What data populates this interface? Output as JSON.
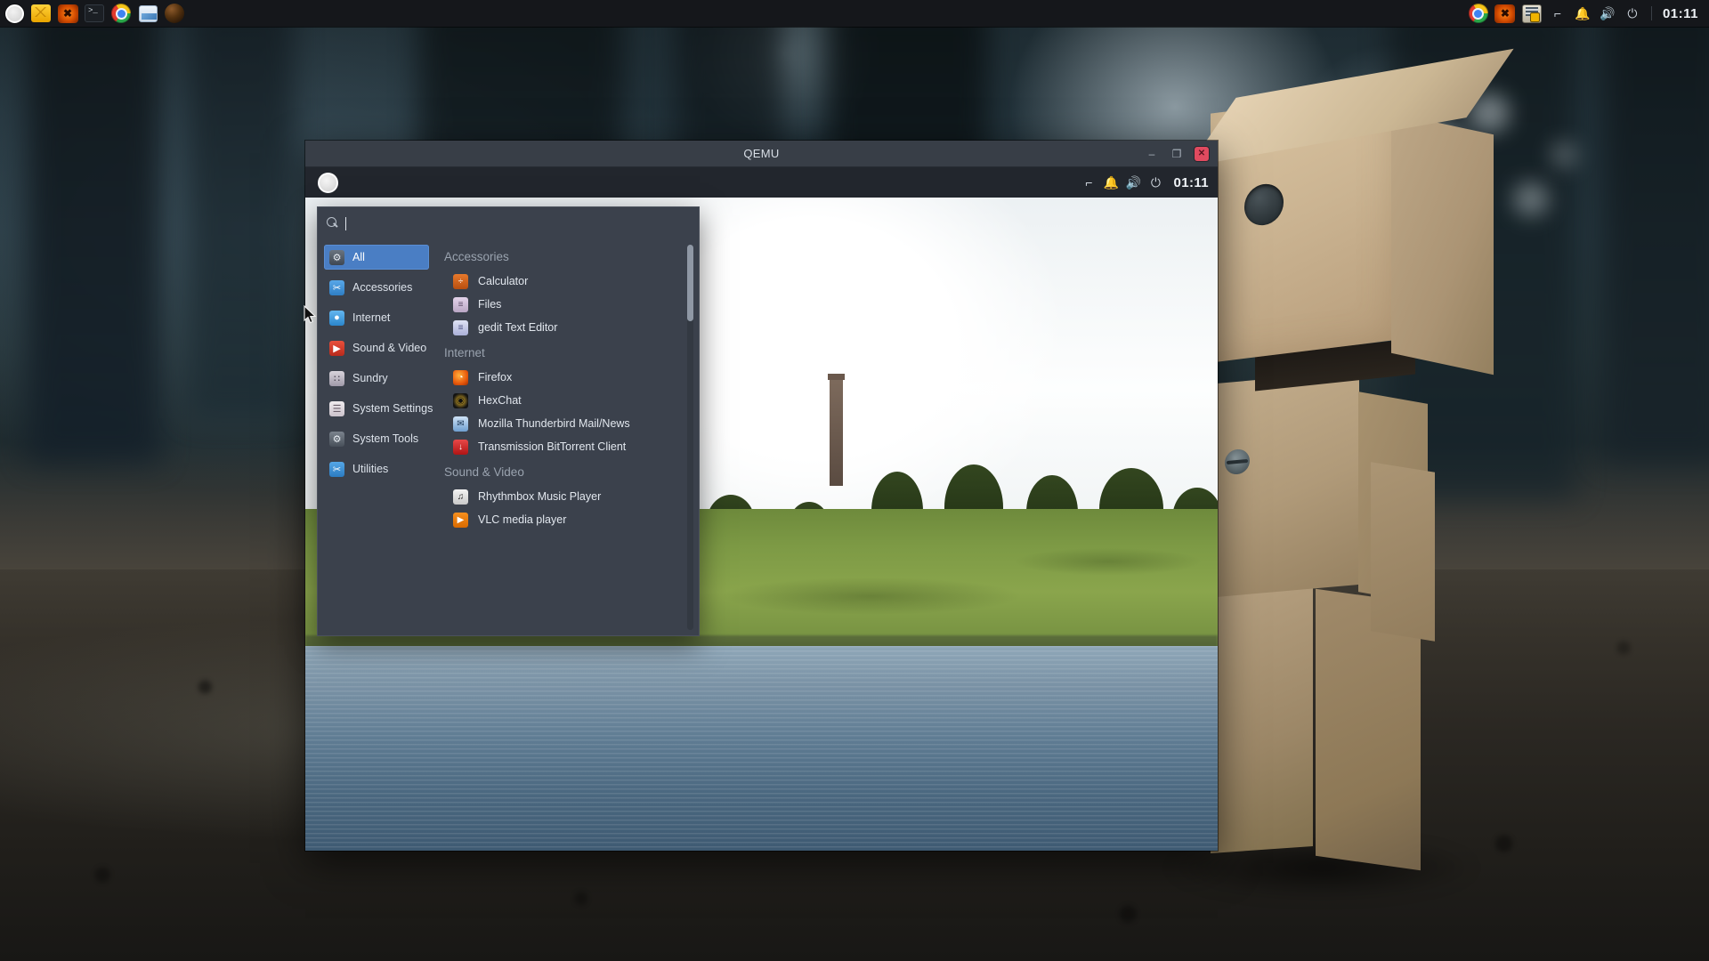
{
  "desktop": {
    "wallpaper_description": "danbo-cardboard-robot-on-blurred-street"
  },
  "top_panel": {
    "launchers": [
      {
        "name": "mint-menu-icon",
        "label": "Menu"
      },
      {
        "name": "crown-icon",
        "label": "Crown"
      },
      {
        "name": "x-app-icon",
        "label": "X"
      },
      {
        "name": "terminal-icon",
        "label": "Terminal"
      },
      {
        "name": "chrome-icon",
        "label": "Google Chrome"
      },
      {
        "name": "document-viewer-icon",
        "label": "Document Viewer"
      },
      {
        "name": "sphere-icon",
        "label": "Sphere"
      }
    ],
    "tray": [
      {
        "name": "chrome-tray-icon",
        "label": "Chrome"
      },
      {
        "name": "x-tray-icon",
        "label": "X"
      },
      {
        "name": "update-manager-icon",
        "label": "Update Manager"
      },
      {
        "name": "network-icon",
        "glyph": "⌐",
        "label": "Network"
      },
      {
        "name": "notification-bell-icon",
        "glyph": "🔔",
        "label": "Notifications"
      },
      {
        "name": "volume-icon",
        "glyph": "🔊",
        "label": "Volume"
      },
      {
        "name": "power-icon",
        "glyph": "⏻",
        "label": "Power"
      }
    ],
    "clock": "01:11"
  },
  "qemu_window": {
    "title": "QEMU",
    "buttons": {
      "minimize": "–",
      "maximize": "❐",
      "close": "✕"
    }
  },
  "guest_panel": {
    "menu_button": "menu",
    "tray": [
      {
        "name": "network-icon",
        "glyph": "⌐"
      },
      {
        "name": "notification-bell-icon",
        "glyph": "🔔"
      },
      {
        "name": "volume-icon",
        "glyph": "🔊"
      },
      {
        "name": "power-icon",
        "glyph": "⏻"
      }
    ],
    "clock": "01:11"
  },
  "mint_menu": {
    "search": {
      "value": "",
      "placeholder": ""
    },
    "categories": [
      {
        "label": "All",
        "icon": "gear-icon",
        "icon_class": "ci-all",
        "glyph": "⚙",
        "active": true
      },
      {
        "label": "Accessories",
        "icon": "scissors-icon",
        "icon_class": "ci-acc",
        "glyph": "✂",
        "active": false
      },
      {
        "label": "Internet",
        "icon": "globe-icon",
        "icon_class": "ci-net",
        "glyph": "●",
        "active": false
      },
      {
        "label": "Sound & Video",
        "icon": "play-icon",
        "icon_class": "ci-snd",
        "glyph": "▶",
        "active": false
      },
      {
        "label": "Sundry",
        "icon": "grid-icon",
        "icon_class": "ci-sun",
        "glyph": "∷",
        "active": false
      },
      {
        "label": "System Settings",
        "icon": "sliders-icon",
        "icon_class": "ci-sys",
        "glyph": "☰",
        "active": false
      },
      {
        "label": "System Tools",
        "icon": "gear-icon",
        "icon_class": "ci-tools",
        "glyph": "⚙",
        "active": false
      },
      {
        "label": "Utilities",
        "icon": "scissors-icon",
        "icon_class": "ci-util",
        "glyph": "✂",
        "active": false
      }
    ],
    "groups": [
      {
        "title": "Accessories",
        "apps": [
          {
            "label": "Calculator",
            "icon": "calculator-icon",
            "icon_class": "ai-calc",
            "glyph": "÷"
          },
          {
            "label": "Files",
            "icon": "files-icon",
            "icon_class": "ai-files",
            "glyph": "≡"
          },
          {
            "label": "gedit Text Editor",
            "icon": "text-editor-icon",
            "icon_class": "ai-gedit",
            "glyph": "≡"
          }
        ]
      },
      {
        "title": "Internet",
        "apps": [
          {
            "label": "Firefox",
            "icon": "firefox-icon",
            "icon_class": "ai-ff",
            "glyph": "◔"
          },
          {
            "label": "HexChat",
            "icon": "hexchat-icon",
            "icon_class": "ai-hex",
            "glyph": "◉"
          },
          {
            "label": "Mozilla Thunderbird Mail/News",
            "icon": "thunderbird-icon",
            "icon_class": "ai-tb",
            "glyph": "✉"
          },
          {
            "label": "Transmission BitTorrent Client",
            "icon": "transmission-icon",
            "icon_class": "ai-tr",
            "glyph": "↓"
          }
        ]
      },
      {
        "title": "Sound & Video",
        "apps": [
          {
            "label": "Rhythmbox Music Player",
            "icon": "rhythmbox-icon",
            "icon_class": "ai-rb",
            "glyph": "♫"
          },
          {
            "label": "VLC media player",
            "icon": "vlc-icon",
            "icon_class": "ai-vlc",
            "glyph": "▶"
          }
        ]
      }
    ]
  },
  "colors": {
    "panel_bg": "#15171b",
    "menu_bg": "#3b414c",
    "menu_accent": "#4a7ec4",
    "titlebar_bg": "#383e47",
    "close_btn": "#e04a5f"
  }
}
